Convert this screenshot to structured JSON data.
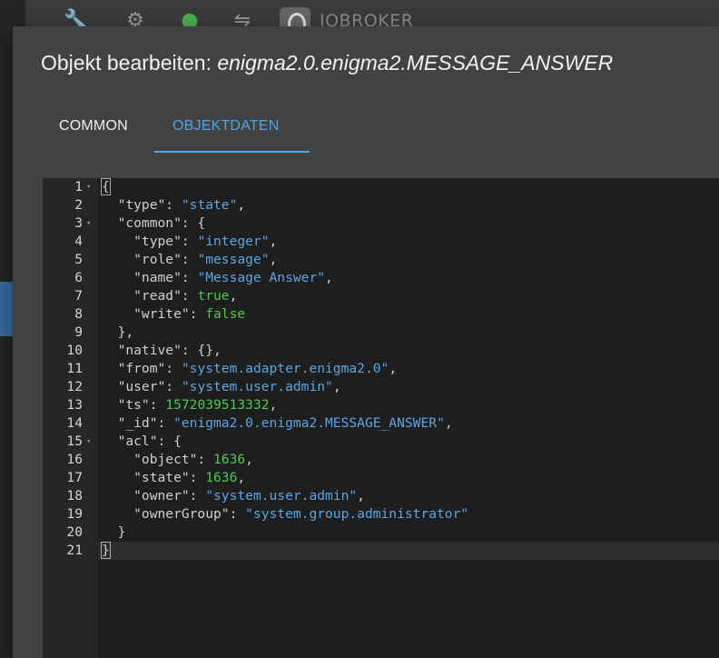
{
  "background": {
    "logo_text": "IOBROKER"
  },
  "dialog": {
    "title_prefix": "Objekt bearbeiten: ",
    "title_object": "enigma2.0.enigma2.MESSAGE_ANSWER",
    "tabs": [
      {
        "label": "COMMON",
        "active": false
      },
      {
        "label": "OBJEKTDATEN",
        "active": true
      }
    ]
  },
  "editor": {
    "lines": [
      {
        "n": "1",
        "fold": true,
        "tokens": [
          {
            "t": "{",
            "c": "p",
            "hl": true
          }
        ]
      },
      {
        "n": "2",
        "fold": false,
        "tokens": [
          {
            "t": "  \"type\": ",
            "c": "k"
          },
          {
            "t": "\"state\"",
            "c": "s"
          },
          {
            "t": ",",
            "c": "p"
          }
        ]
      },
      {
        "n": "3",
        "fold": true,
        "tokens": [
          {
            "t": "  \"common\": {",
            "c": "k"
          }
        ]
      },
      {
        "n": "4",
        "fold": false,
        "tokens": [
          {
            "t": "    \"type\": ",
            "c": "k"
          },
          {
            "t": "\"integer\"",
            "c": "s"
          },
          {
            "t": ",",
            "c": "p"
          }
        ]
      },
      {
        "n": "5",
        "fold": false,
        "tokens": [
          {
            "t": "    \"role\": ",
            "c": "k"
          },
          {
            "t": "\"message\"",
            "c": "s"
          },
          {
            "t": ",",
            "c": "p"
          }
        ]
      },
      {
        "n": "6",
        "fold": false,
        "tokens": [
          {
            "t": "    \"name\": ",
            "c": "k"
          },
          {
            "t": "\"Message Answer\"",
            "c": "s"
          },
          {
            "t": ",",
            "c": "p"
          }
        ]
      },
      {
        "n": "7",
        "fold": false,
        "tokens": [
          {
            "t": "    \"read\": ",
            "c": "k"
          },
          {
            "t": "true",
            "c": "b"
          },
          {
            "t": ",",
            "c": "p"
          }
        ]
      },
      {
        "n": "8",
        "fold": false,
        "tokens": [
          {
            "t": "    \"write\": ",
            "c": "k"
          },
          {
            "t": "false",
            "c": "b"
          }
        ]
      },
      {
        "n": "9",
        "fold": false,
        "tokens": [
          {
            "t": "  },",
            "c": "p"
          }
        ]
      },
      {
        "n": "10",
        "fold": false,
        "tokens": [
          {
            "t": "  \"native\": {},",
            "c": "k"
          }
        ]
      },
      {
        "n": "11",
        "fold": false,
        "tokens": [
          {
            "t": "  \"from\": ",
            "c": "k"
          },
          {
            "t": "\"system.adapter.enigma2.0\"",
            "c": "s"
          },
          {
            "t": ",",
            "c": "p"
          }
        ]
      },
      {
        "n": "12",
        "fold": false,
        "tokens": [
          {
            "t": "  \"user\": ",
            "c": "k"
          },
          {
            "t": "\"system.user.admin\"",
            "c": "s"
          },
          {
            "t": ",",
            "c": "p"
          }
        ]
      },
      {
        "n": "13",
        "fold": false,
        "tokens": [
          {
            "t": "  \"ts\": ",
            "c": "k"
          },
          {
            "t": "1572039513332",
            "c": "n"
          },
          {
            "t": ",",
            "c": "p"
          }
        ]
      },
      {
        "n": "14",
        "fold": false,
        "tokens": [
          {
            "t": "  \"_id\": ",
            "c": "k"
          },
          {
            "t": "\"enigma2.0.enigma2.MESSAGE_ANSWER\"",
            "c": "s"
          },
          {
            "t": ",",
            "c": "p"
          }
        ]
      },
      {
        "n": "15",
        "fold": true,
        "tokens": [
          {
            "t": "  \"acl\": {",
            "c": "k"
          }
        ]
      },
      {
        "n": "16",
        "fold": false,
        "tokens": [
          {
            "t": "    \"object\": ",
            "c": "k"
          },
          {
            "t": "1636",
            "c": "n"
          },
          {
            "t": ",",
            "c": "p"
          }
        ]
      },
      {
        "n": "17",
        "fold": false,
        "tokens": [
          {
            "t": "    \"state\": ",
            "c": "k"
          },
          {
            "t": "1636",
            "c": "n"
          },
          {
            "t": ",",
            "c": "p"
          }
        ]
      },
      {
        "n": "18",
        "fold": false,
        "tokens": [
          {
            "t": "    \"owner\": ",
            "c": "k"
          },
          {
            "t": "\"system.user.admin\"",
            "c": "s"
          },
          {
            "t": ",",
            "c": "p"
          }
        ]
      },
      {
        "n": "19",
        "fold": false,
        "tokens": [
          {
            "t": "    \"ownerGroup\": ",
            "c": "k"
          },
          {
            "t": "\"system.group.administrator\"",
            "c": "s"
          }
        ]
      },
      {
        "n": "20",
        "fold": false,
        "tokens": [
          {
            "t": "  }",
            "c": "p"
          }
        ]
      },
      {
        "n": "21",
        "fold": false,
        "active": true,
        "tokens": [
          {
            "t": "}",
            "c": "p",
            "hl": true
          }
        ]
      }
    ]
  },
  "colors": {
    "accent": "#4fa3e8",
    "string": "#5ea5e5",
    "number": "#4ec94e"
  }
}
